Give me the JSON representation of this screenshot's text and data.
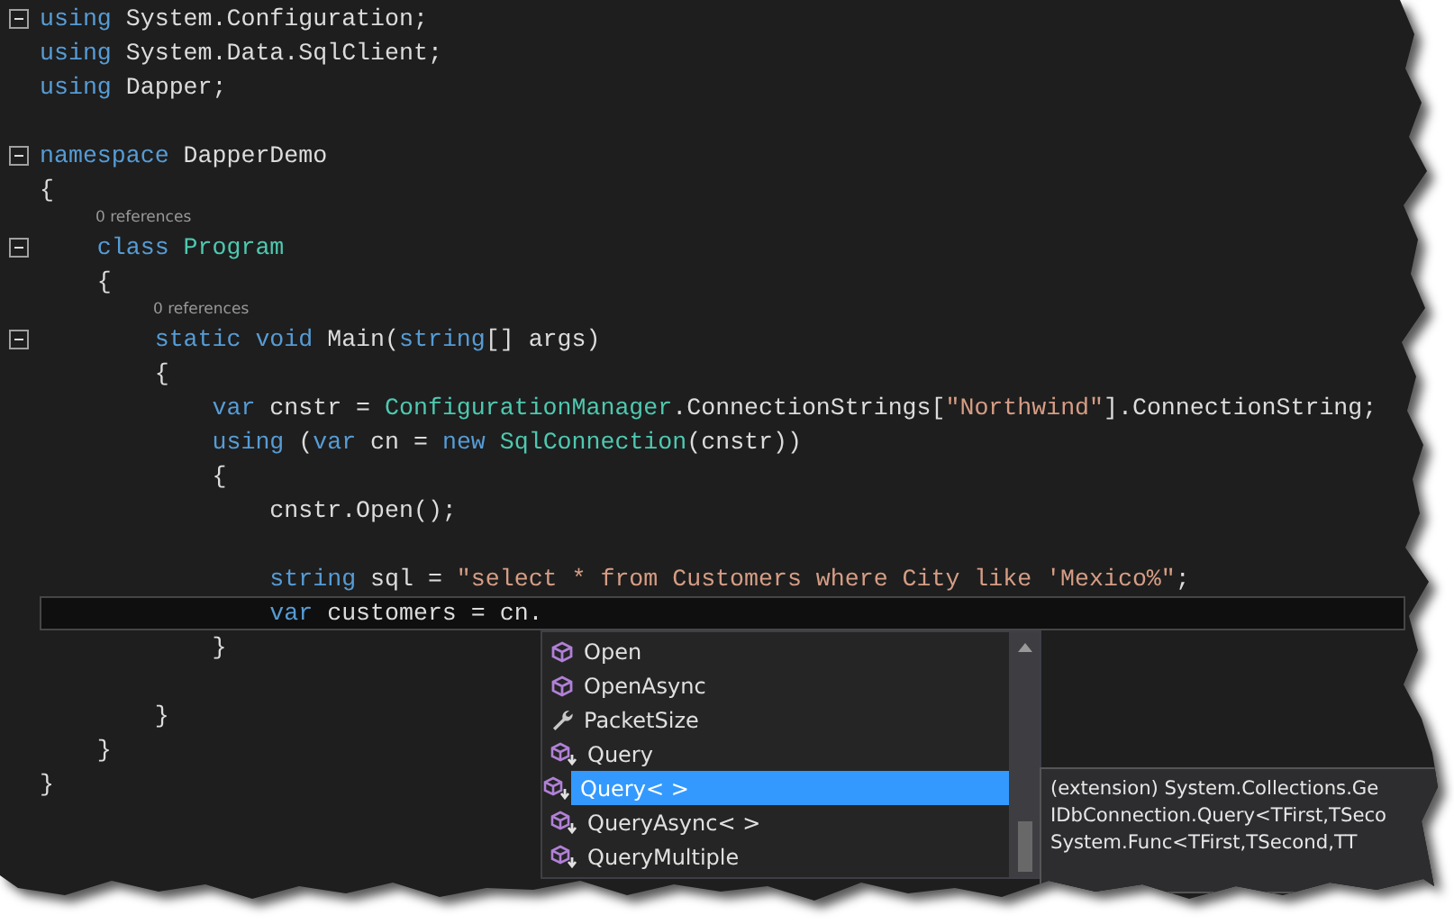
{
  "editor": {
    "lines": [
      {
        "kind": "code",
        "fold_start": true,
        "current": false,
        "tokens": [
          {
            "kind": "keyword",
            "text": "using"
          },
          {
            "kind": "plain",
            "text": " System.Configuration;"
          }
        ]
      },
      {
        "kind": "code",
        "fold_start": false,
        "current": false,
        "tokens": [
          {
            "kind": "keyword",
            "text": "using"
          },
          {
            "kind": "plain",
            "text": " System.Data.SqlClient;"
          }
        ]
      },
      {
        "kind": "code",
        "fold_start": false,
        "current": false,
        "tokens": [
          {
            "kind": "keyword",
            "text": "using"
          },
          {
            "kind": "plain",
            "text": " Dapper;"
          }
        ]
      },
      {
        "kind": "blank"
      },
      {
        "kind": "code",
        "fold_start": true,
        "current": false,
        "tokens": [
          {
            "kind": "keyword",
            "text": "namespace"
          },
          {
            "kind": "plain",
            "text": " DapperDemo"
          }
        ]
      },
      {
        "kind": "code",
        "fold_start": false,
        "current": false,
        "tokens": [
          {
            "kind": "plain",
            "text": "{"
          }
        ]
      },
      {
        "kind": "codelens",
        "text": "0 references"
      },
      {
        "kind": "code",
        "fold_start": true,
        "current": false,
        "tokens": [
          {
            "kind": "keyword",
            "text": "    class "
          },
          {
            "kind": "type",
            "text": "Program"
          }
        ]
      },
      {
        "kind": "code",
        "fold_start": false,
        "current": false,
        "tokens": [
          {
            "kind": "plain",
            "text": "    {"
          }
        ]
      },
      {
        "kind": "codelens",
        "text": "0 references"
      },
      {
        "kind": "code",
        "fold_start": true,
        "current": false,
        "tokens": [
          {
            "kind": "keyword",
            "text": "        static void"
          },
          {
            "kind": "plain",
            "text": " Main("
          },
          {
            "kind": "keyword",
            "text": "string"
          },
          {
            "kind": "plain",
            "text": "[] args)"
          }
        ]
      },
      {
        "kind": "code",
        "fold_start": false,
        "current": false,
        "tokens": [
          {
            "kind": "plain",
            "text": "        {"
          }
        ]
      },
      {
        "kind": "code",
        "fold_start": false,
        "current": false,
        "tokens": [
          {
            "kind": "keyword",
            "text": "            var"
          },
          {
            "kind": "plain",
            "text": " cnstr = "
          },
          {
            "kind": "type",
            "text": "ConfigurationManager"
          },
          {
            "kind": "plain",
            "text": ".ConnectionStrings["
          },
          {
            "kind": "string",
            "text": "\"Northwind\""
          },
          {
            "kind": "plain",
            "text": "].ConnectionString;"
          }
        ]
      },
      {
        "kind": "code",
        "fold_start": false,
        "current": false,
        "tokens": [
          {
            "kind": "keyword",
            "text": "            using"
          },
          {
            "kind": "plain",
            "text": " ("
          },
          {
            "kind": "keyword",
            "text": "var"
          },
          {
            "kind": "plain",
            "text": " cn = "
          },
          {
            "kind": "keyword",
            "text": "new "
          },
          {
            "kind": "type",
            "text": "SqlConnection"
          },
          {
            "kind": "plain",
            "text": "(cnstr))"
          }
        ]
      },
      {
        "kind": "code",
        "fold_start": false,
        "current": false,
        "tokens": [
          {
            "kind": "plain",
            "text": "            {"
          }
        ]
      },
      {
        "kind": "code",
        "fold_start": false,
        "current": false,
        "tokens": [
          {
            "kind": "plain",
            "text": "                cnstr.Open();"
          }
        ]
      },
      {
        "kind": "blank"
      },
      {
        "kind": "code",
        "fold_start": false,
        "current": false,
        "tokens": [
          {
            "kind": "keyword",
            "text": "                string"
          },
          {
            "kind": "plain",
            "text": " sql = "
          },
          {
            "kind": "string",
            "text": "\"select * from Customers where City like 'Mexico%\""
          },
          {
            "kind": "plain",
            "text": ";"
          }
        ]
      },
      {
        "kind": "code",
        "fold_start": false,
        "current": true,
        "tokens": [
          {
            "kind": "keyword",
            "text": "                var"
          },
          {
            "kind": "plain",
            "text": " customers = cn."
          }
        ]
      },
      {
        "kind": "code",
        "fold_start": false,
        "current": false,
        "tokens": [
          {
            "kind": "plain",
            "text": "            }"
          }
        ]
      },
      {
        "kind": "blank"
      },
      {
        "kind": "code",
        "fold_start": false,
        "current": false,
        "tokens": [
          {
            "kind": "plain",
            "text": "        }"
          }
        ]
      },
      {
        "kind": "code",
        "fold_start": false,
        "current": false,
        "tokens": [
          {
            "kind": "plain",
            "text": "    }"
          }
        ]
      },
      {
        "kind": "code",
        "fold_start": false,
        "current": false,
        "tokens": [
          {
            "kind": "plain",
            "text": "}"
          }
        ]
      }
    ]
  },
  "completion": {
    "items": [
      {
        "kind": "method",
        "label": "Open",
        "selected": false
      },
      {
        "kind": "method",
        "label": "OpenAsync",
        "selected": false
      },
      {
        "kind": "property",
        "label": "PacketSize",
        "selected": false
      },
      {
        "kind": "extension",
        "label": "Query",
        "selected": false
      },
      {
        "kind": "extension",
        "label": "Query< >",
        "selected": true
      },
      {
        "kind": "extension",
        "label": "QueryAsync< >",
        "selected": false
      },
      {
        "kind": "extension",
        "label": "QueryMultiple",
        "selected": false
      }
    ]
  },
  "tooltip": {
    "lines": [
      "(extension) System.Collections.Ge",
      "IDbConnection.Query<TFirst,TSeco",
      "System.Func<TFirst,TSecond,TT"
    ]
  }
}
